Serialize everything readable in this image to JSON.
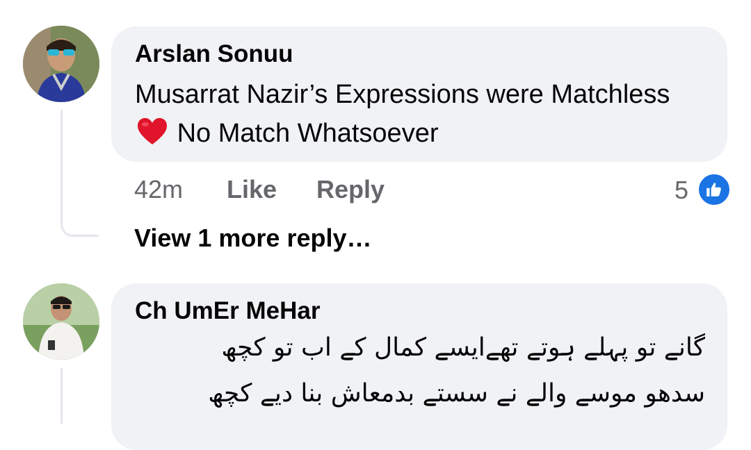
{
  "comments": [
    {
      "author": "Arslan Sonuu",
      "text_before_emoji": "Musarrat Nazir’s Expressions were Matchless",
      "text_after_emoji": "No Match Whatsoever",
      "emoji": "heart",
      "time": "42m",
      "like_label": "Like",
      "reply_label": "Reply",
      "reaction_count": "5",
      "reaction_icon": "like-icon",
      "view_more_replies": "View 1 more reply…"
    },
    {
      "author": "Ch UmEr MeHar",
      "text_lines": [
        "گانے تو پہلے ہوتے تھےایسے کمال کے اب تو کچھ",
        "سدھو موسے والے نے سستے بدمعاش  بنا دیے کچھ"
      ]
    }
  ],
  "colors": {
    "bubble": "#f0f2f5",
    "secondary_text": "#65676b",
    "like_blue": "#1b74e4",
    "heart_red": "#e0142a"
  }
}
